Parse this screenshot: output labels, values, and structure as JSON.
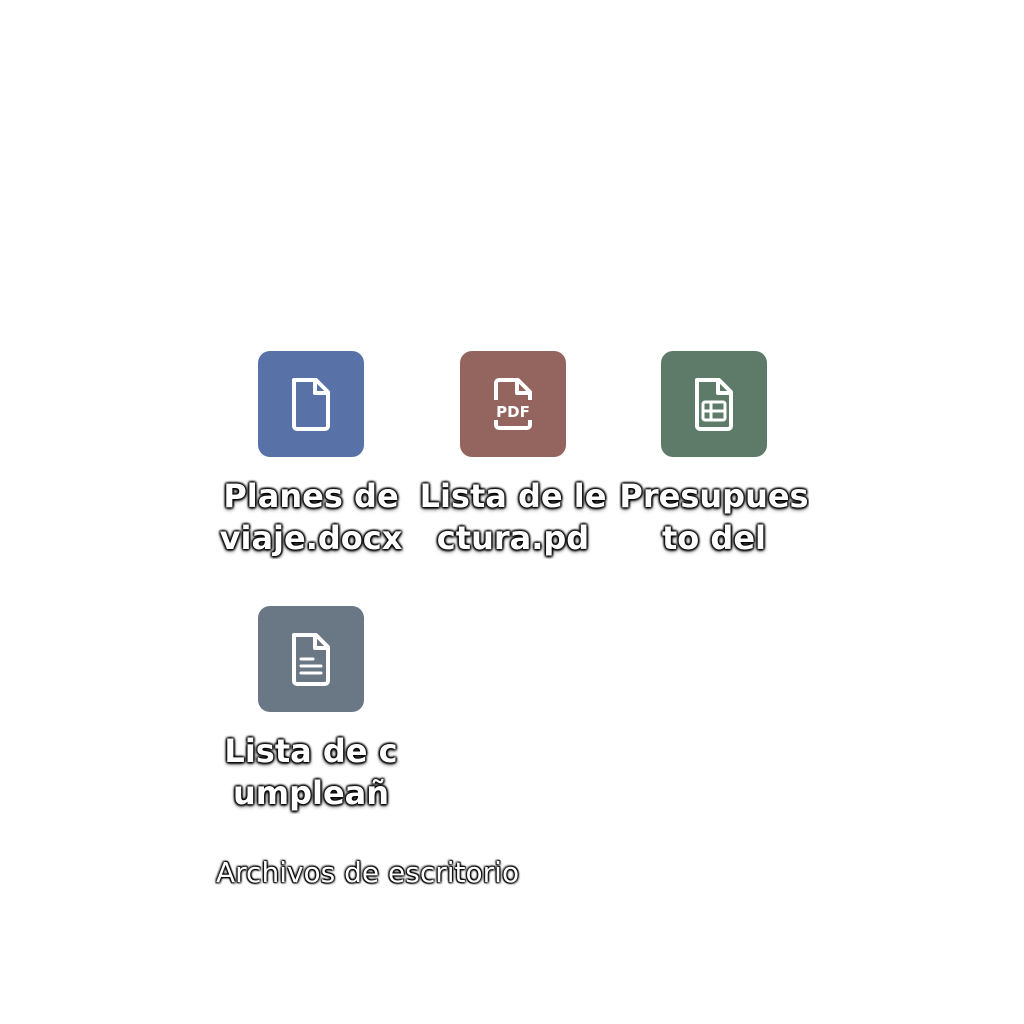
{
  "desktop": {
    "items": [
      {
        "label": "Planes de viaje.docx",
        "icon": "document-icon",
        "color": "#5872A7"
      },
      {
        "label": "Lista de lectura.pd",
        "icon": "pdf-icon",
        "color": "#94645E"
      },
      {
        "label": "Presupuesto del",
        "icon": "spreadsheet-icon",
        "color": "#5E7B6A"
      },
      {
        "label": "Lista de cumpleañ",
        "icon": "text-document-icon",
        "color": "#6A7885"
      }
    ],
    "footer_label": "Archivos de escritorio"
  }
}
